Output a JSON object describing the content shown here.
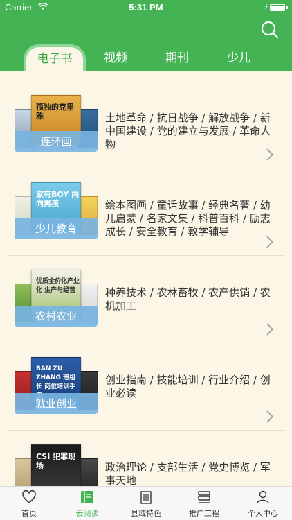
{
  "status": {
    "carrier": "Carrier",
    "time": "5:31 PM"
  },
  "tabs": [
    {
      "label": "电子书"
    },
    {
      "label": "视频"
    },
    {
      "label": "期刊"
    },
    {
      "label": "少儿"
    }
  ],
  "categories": [
    {
      "name": "连环画",
      "desc": "土地革命 / 抗日战争 / 解放战争 / 新中国建设 / 党的建立与发展 / 革命人物",
      "cover_text": "孤独的克里雅"
    },
    {
      "name": "少儿教育",
      "desc": "绘本图画 / 童话故事 / 经典名著 / 幼儿启蒙 / 名家文集 / 科普百科 / 励志成长 / 安全教育 / 教学辅导",
      "cover_text": "家有BOY 内向男孩"
    },
    {
      "name": "农村农业",
      "desc": "种养技术 / 农林畜牧 / 农产供销 / 农机加工",
      "cover_text": "优质全价化产业化 生产与经营"
    },
    {
      "name": "就业创业",
      "desc": "创业指南 / 技能培训 / 行业介绍 / 创业必读",
      "cover_text": "BAN ZU ZHANG 班组长 岗位培训手册"
    },
    {
      "name": "",
      "desc": "政治理论 / 支部生活 / 党史博览 / 军事天地",
      "cover_text": "CSI 犯罪现场"
    }
  ],
  "tabbar": [
    {
      "label": "首页",
      "icon": "heart-icon"
    },
    {
      "label": "云阅读",
      "icon": "book-icon"
    },
    {
      "label": "县域特色",
      "icon": "building-icon"
    },
    {
      "label": "推广工程",
      "icon": "layers-icon"
    },
    {
      "label": "个人中心",
      "icon": "person-icon"
    }
  ],
  "colors": {
    "brand": "#43b353",
    "panel": "#fbf6e6",
    "label_blue": "#78b4e2"
  }
}
